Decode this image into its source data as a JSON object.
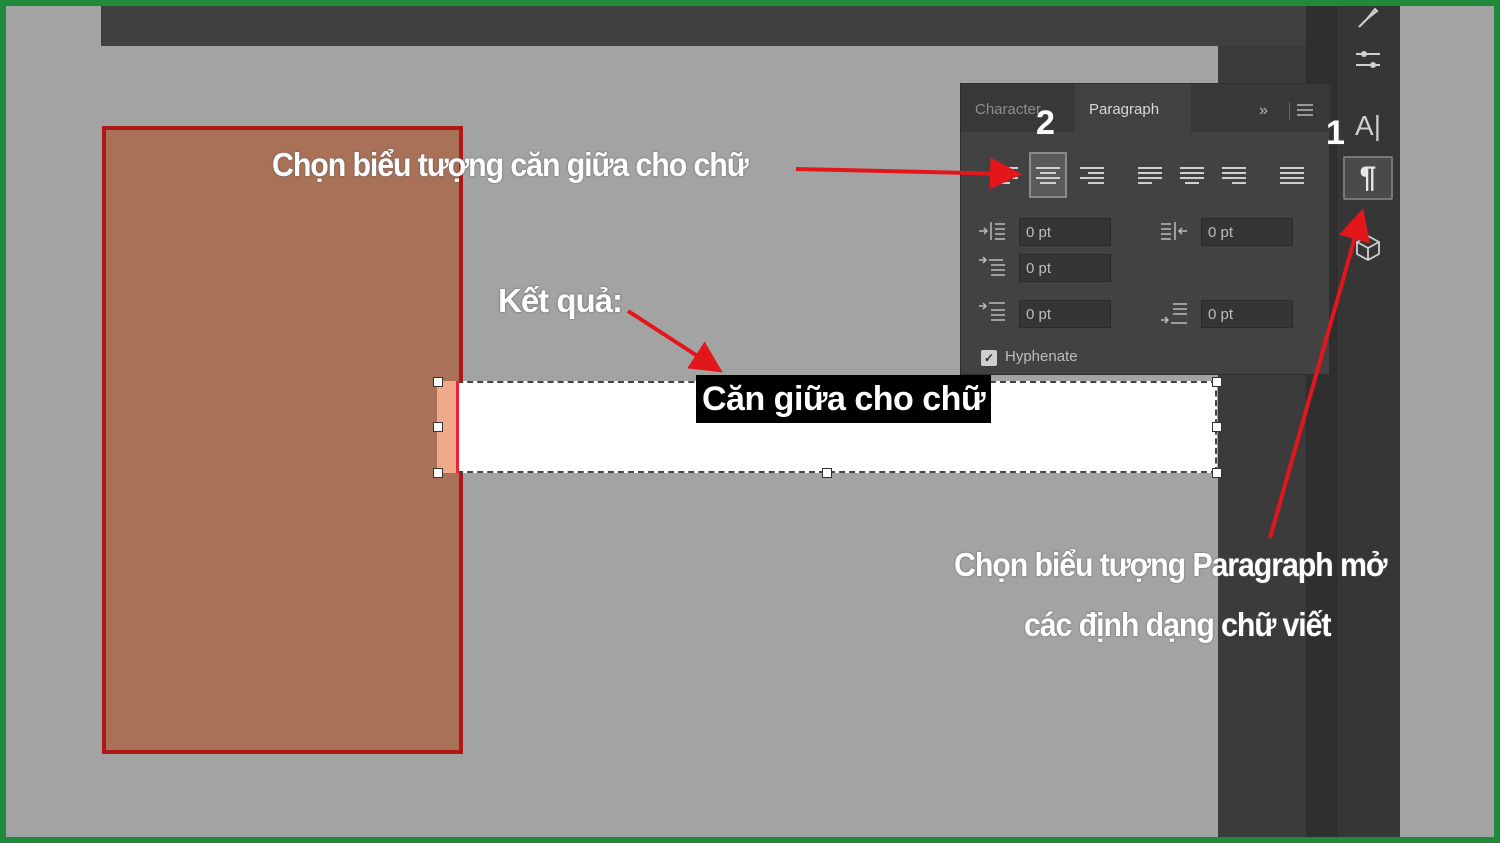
{
  "panel": {
    "tabs": [
      "Character",
      "Paragraph"
    ],
    "active_tab": "Paragraph",
    "collapse_icon": "double-chevron-right-icon",
    "menu_icon": "panel-menu-icon",
    "alignment_buttons": [
      "align-left",
      "align-center",
      "align-right",
      "justify-last-left",
      "justify-last-center",
      "justify-last-right",
      "justify-all"
    ],
    "selected_alignment": "align-center",
    "fields": {
      "left_indent": "0 pt",
      "right_indent": "0 pt",
      "first_line_indent": "0 pt",
      "space_before": "0 pt",
      "space_after": "0 pt"
    },
    "hyphenate_label": "Hyphenate",
    "hyphenate_checked": true
  },
  "tools": {
    "items": [
      "brush-icon",
      "properties-icon",
      "character-icon",
      "paragraph-icon",
      "3d-cube-icon"
    ],
    "character_glyph": "A|",
    "paragraph_glyph": "¶"
  },
  "canvas": {
    "frame_text": "Căn giữa cho chữ",
    "shape_fill": "#a87158",
    "shape_stroke": "#b01717"
  },
  "annotations": {
    "center_align": "Chọn biểu tượng căn giữa cho chữ",
    "result": "Kết quả:",
    "paragraph_line1": "Chọn biểu tượng Paragraph mở",
    "paragraph_line2": "các định dạng chữ viết",
    "step1": "1",
    "step2": "2",
    "arrow_color": "#e3161c"
  }
}
